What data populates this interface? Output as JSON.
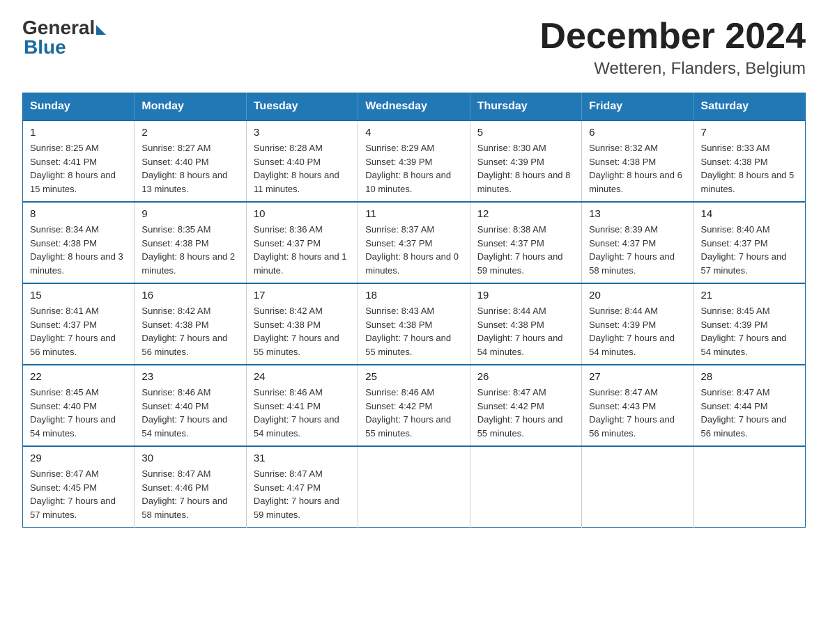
{
  "logo": {
    "general": "General",
    "blue": "Blue"
  },
  "title": {
    "month": "December 2024",
    "location": "Wetteren, Flanders, Belgium"
  },
  "days_of_week": [
    "Sunday",
    "Monday",
    "Tuesday",
    "Wednesday",
    "Thursday",
    "Friday",
    "Saturday"
  ],
  "weeks": [
    [
      {
        "day": "1",
        "sunrise": "8:25 AM",
        "sunset": "4:41 PM",
        "daylight": "8 hours and 15 minutes."
      },
      {
        "day": "2",
        "sunrise": "8:27 AM",
        "sunset": "4:40 PM",
        "daylight": "8 hours and 13 minutes."
      },
      {
        "day": "3",
        "sunrise": "8:28 AM",
        "sunset": "4:40 PM",
        "daylight": "8 hours and 11 minutes."
      },
      {
        "day": "4",
        "sunrise": "8:29 AM",
        "sunset": "4:39 PM",
        "daylight": "8 hours and 10 minutes."
      },
      {
        "day": "5",
        "sunrise": "8:30 AM",
        "sunset": "4:39 PM",
        "daylight": "8 hours and 8 minutes."
      },
      {
        "day": "6",
        "sunrise": "8:32 AM",
        "sunset": "4:38 PM",
        "daylight": "8 hours and 6 minutes."
      },
      {
        "day": "7",
        "sunrise": "8:33 AM",
        "sunset": "4:38 PM",
        "daylight": "8 hours and 5 minutes."
      }
    ],
    [
      {
        "day": "8",
        "sunrise": "8:34 AM",
        "sunset": "4:38 PM",
        "daylight": "8 hours and 3 minutes."
      },
      {
        "day": "9",
        "sunrise": "8:35 AM",
        "sunset": "4:38 PM",
        "daylight": "8 hours and 2 minutes."
      },
      {
        "day": "10",
        "sunrise": "8:36 AM",
        "sunset": "4:37 PM",
        "daylight": "8 hours and 1 minute."
      },
      {
        "day": "11",
        "sunrise": "8:37 AM",
        "sunset": "4:37 PM",
        "daylight": "8 hours and 0 minutes."
      },
      {
        "day": "12",
        "sunrise": "8:38 AM",
        "sunset": "4:37 PM",
        "daylight": "7 hours and 59 minutes."
      },
      {
        "day": "13",
        "sunrise": "8:39 AM",
        "sunset": "4:37 PM",
        "daylight": "7 hours and 58 minutes."
      },
      {
        "day": "14",
        "sunrise": "8:40 AM",
        "sunset": "4:37 PM",
        "daylight": "7 hours and 57 minutes."
      }
    ],
    [
      {
        "day": "15",
        "sunrise": "8:41 AM",
        "sunset": "4:37 PM",
        "daylight": "7 hours and 56 minutes."
      },
      {
        "day": "16",
        "sunrise": "8:42 AM",
        "sunset": "4:38 PM",
        "daylight": "7 hours and 56 minutes."
      },
      {
        "day": "17",
        "sunrise": "8:42 AM",
        "sunset": "4:38 PM",
        "daylight": "7 hours and 55 minutes."
      },
      {
        "day": "18",
        "sunrise": "8:43 AM",
        "sunset": "4:38 PM",
        "daylight": "7 hours and 55 minutes."
      },
      {
        "day": "19",
        "sunrise": "8:44 AM",
        "sunset": "4:38 PM",
        "daylight": "7 hours and 54 minutes."
      },
      {
        "day": "20",
        "sunrise": "8:44 AM",
        "sunset": "4:39 PM",
        "daylight": "7 hours and 54 minutes."
      },
      {
        "day": "21",
        "sunrise": "8:45 AM",
        "sunset": "4:39 PM",
        "daylight": "7 hours and 54 minutes."
      }
    ],
    [
      {
        "day": "22",
        "sunrise": "8:45 AM",
        "sunset": "4:40 PM",
        "daylight": "7 hours and 54 minutes."
      },
      {
        "day": "23",
        "sunrise": "8:46 AM",
        "sunset": "4:40 PM",
        "daylight": "7 hours and 54 minutes."
      },
      {
        "day": "24",
        "sunrise": "8:46 AM",
        "sunset": "4:41 PM",
        "daylight": "7 hours and 54 minutes."
      },
      {
        "day": "25",
        "sunrise": "8:46 AM",
        "sunset": "4:42 PM",
        "daylight": "7 hours and 55 minutes."
      },
      {
        "day": "26",
        "sunrise": "8:47 AM",
        "sunset": "4:42 PM",
        "daylight": "7 hours and 55 minutes."
      },
      {
        "day": "27",
        "sunrise": "8:47 AM",
        "sunset": "4:43 PM",
        "daylight": "7 hours and 56 minutes."
      },
      {
        "day": "28",
        "sunrise": "8:47 AM",
        "sunset": "4:44 PM",
        "daylight": "7 hours and 56 minutes."
      }
    ],
    [
      {
        "day": "29",
        "sunrise": "8:47 AM",
        "sunset": "4:45 PM",
        "daylight": "7 hours and 57 minutes."
      },
      {
        "day": "30",
        "sunrise": "8:47 AM",
        "sunset": "4:46 PM",
        "daylight": "7 hours and 58 minutes."
      },
      {
        "day": "31",
        "sunrise": "8:47 AM",
        "sunset": "4:47 PM",
        "daylight": "7 hours and 59 minutes."
      },
      null,
      null,
      null,
      null
    ]
  ]
}
